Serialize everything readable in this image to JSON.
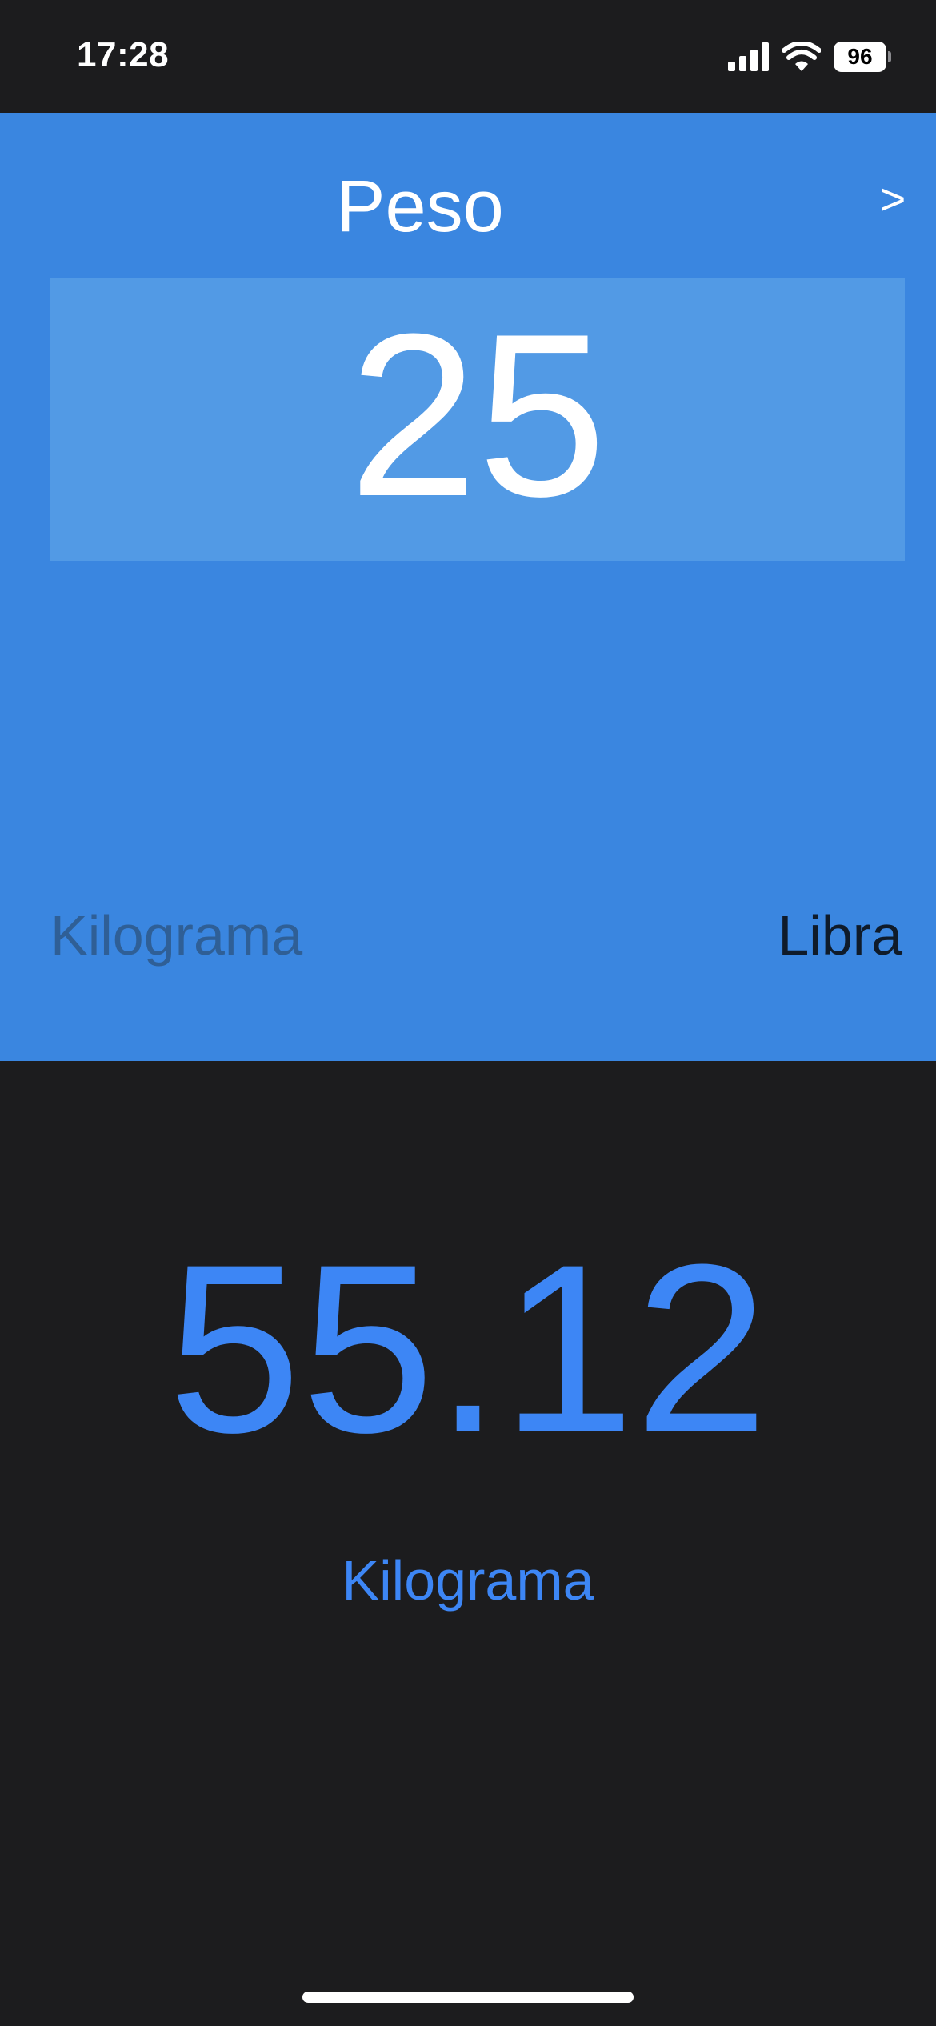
{
  "status_bar": {
    "time": "17:28",
    "battery": "96",
    "icons": [
      "signal-icon",
      "wifi-icon",
      "battery-icon"
    ]
  },
  "converter": {
    "title": "Peso",
    "next_label": ">",
    "input_value": "25",
    "from_unit": "Kilograma",
    "to_unit": "Libra"
  },
  "result": {
    "value": "55.12",
    "unit": "Kilograma"
  },
  "colors": {
    "panel": "#3a86e0",
    "input_box": "#529ae5",
    "background": "#1c1c1e",
    "accent": "#3d86f5"
  }
}
